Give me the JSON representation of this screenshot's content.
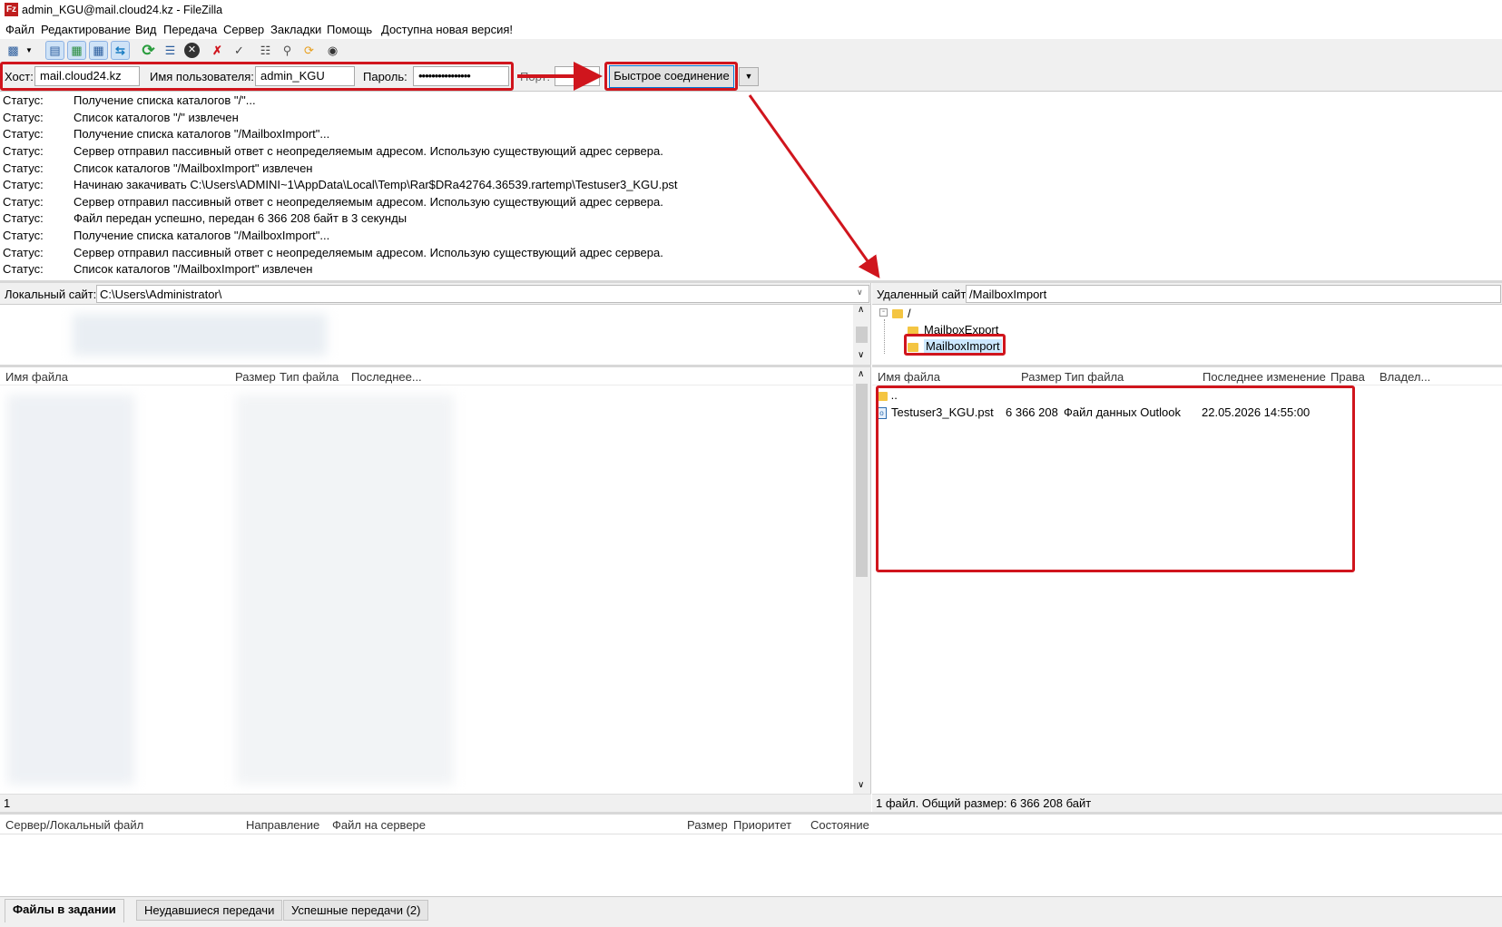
{
  "window": {
    "title": "admin_KGU@mail.cloud24.kz - FileZilla"
  },
  "menu": [
    "Файл",
    "Редактирование",
    "Вид",
    "Передача",
    "Сервер",
    "Закладки",
    "Помощь",
    "Доступна новая версия!"
  ],
  "toolbar": {
    "icons": [
      "site-manager-icon",
      "dropdown-icon",
      "message-log-icon",
      "local-tree-icon",
      "remote-tree-icon",
      "transfer-queue-icon",
      "refresh-icon",
      "process-queue-icon",
      "cancel-icon",
      "disconnect-icon",
      "reconnect-icon",
      "filter-icon",
      "compare-icon",
      "sync-browse-icon",
      "search-icon"
    ]
  },
  "quickconnect": {
    "host_label": "Хост:",
    "host_value": "mail.cloud24.kz",
    "user_label": "Имя пользователя:",
    "user_value": "admin_KGU",
    "pass_label": "Пароль:",
    "pass_value": "••••••••••••••••",
    "port_label": "Порт:",
    "port_value": "",
    "button_label": "Быстрое соединение"
  },
  "log": [
    {
      "k": "Статус:",
      "v": "Получение списка каталогов \"/\"..."
    },
    {
      "k": "Статус:",
      "v": "Список каталогов \"/\" извлечен"
    },
    {
      "k": "Статус:",
      "v": "Получение списка каталогов \"/MailboxImport\"..."
    },
    {
      "k": "Статус:",
      "v": "Сервер отправил пассивный ответ с неопределяемым адресом. Использую существующий адрес сервера."
    },
    {
      "k": "Статус:",
      "v": "Список каталогов \"/MailboxImport\" извлечен"
    },
    {
      "k": "Статус:",
      "v": "Начинаю закачивать C:\\Users\\ADMINI~1\\AppData\\Local\\Temp\\Rar$DRa42764.36539.rartemp\\Testuser3_KGU.pst"
    },
    {
      "k": "Статус:",
      "v": "Сервер отправил пассивный ответ с неопределяемым адресом. Использую существующий адрес сервера."
    },
    {
      "k": "Статус:",
      "v": "Файл передан успешно, передан 6 366 208 байт в 3 секунды"
    },
    {
      "k": "Статус:",
      "v": "Получение списка каталогов \"/MailboxImport\"..."
    },
    {
      "k": "Статус:",
      "v": "Сервер отправил пассивный ответ с неопределяемым адресом. Использую существующий адрес сервера."
    },
    {
      "k": "Статус:",
      "v": "Список каталогов \"/MailboxImport\" извлечен"
    }
  ],
  "local": {
    "site_label": "Локальный сайт:",
    "site_path": "C:\\Users\\Administrator\\",
    "columns": [
      "Имя файла",
      "Размер",
      "Тип файла",
      "Последнее..."
    ],
    "status": "1"
  },
  "remote": {
    "site_label": "Удаленный сайт:",
    "site_path": "/MailboxImport",
    "tree": [
      "/",
      "MailboxExport",
      "MailboxImport"
    ],
    "columns": [
      "Имя файла",
      "Размер",
      "Тип файла",
      "Последнее изменение",
      "Права",
      "Владел..."
    ],
    "parent": "..",
    "files": [
      {
        "name": "Testuser3_KGU.pst",
        "size": "6 366 208",
        "type": "Файл данных Outlook",
        "modified": "22.05.2026 14:55:00"
      }
    ],
    "status": "1 файл. Общий размер: 6 366 208 байт"
  },
  "queue": {
    "columns": [
      "Сервер/Локальный файл",
      "Направление",
      "Файл на сервере",
      "Размер",
      "Приоритет",
      "Состояние"
    ],
    "tabs": [
      "Файлы в задании",
      "Неудавшиеся передачи",
      "Успешные передачи (2)"
    ]
  },
  "colors": {
    "annotation": "#d0151d",
    "folder": "#f4c542"
  }
}
